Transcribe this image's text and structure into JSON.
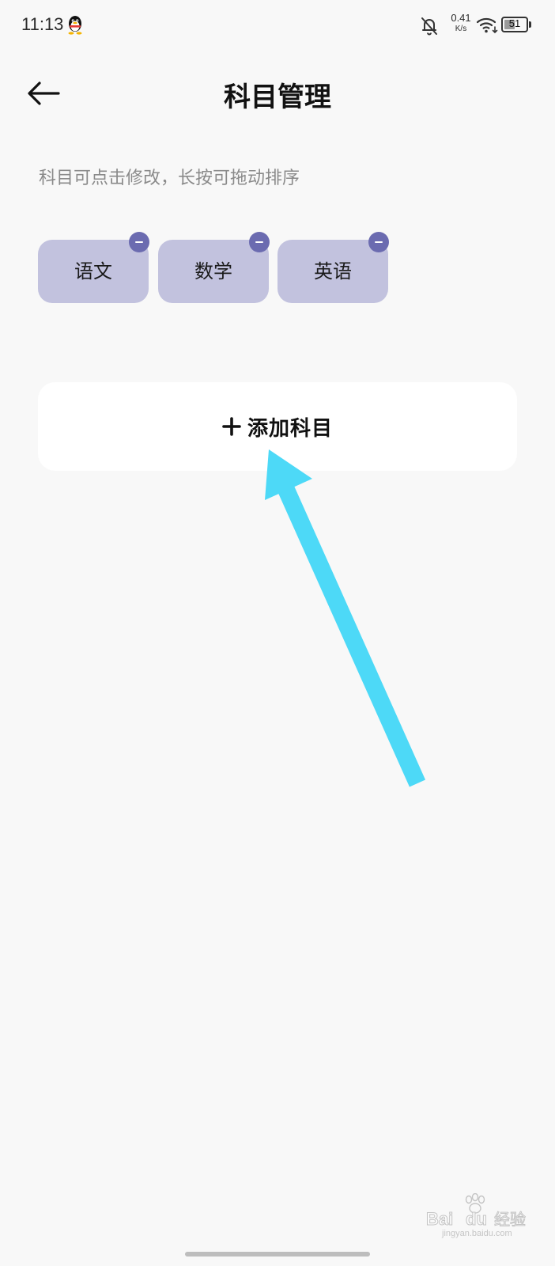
{
  "status_bar": {
    "time": "11:13",
    "net_speed_value": "0.41",
    "net_speed_unit": "K/s",
    "battery_level": "51",
    "battery_fraction": 0.51,
    "icons": [
      "qq-icon",
      "bell-off-icon",
      "wifi-icon",
      "battery-icon"
    ]
  },
  "header": {
    "title": "科目管理",
    "back_icon": "arrow-left-icon"
  },
  "hint": "科目可点击修改，长按可拖动排序",
  "subjects": [
    {
      "label": "语文"
    },
    {
      "label": "数学"
    },
    {
      "label": "英语"
    }
  ],
  "add_button": {
    "icon": "plus-icon",
    "label": "添加科目"
  },
  "annotation": {
    "type": "arrow",
    "color": "#4dd9f7"
  },
  "watermark": {
    "brand": "Bai du 经验",
    "url": "jingyan.baidu.com"
  },
  "colors": {
    "background": "#f8f8f8",
    "chip": "#c2c2de",
    "remove_badge": "#6b6bb0",
    "card": "#ffffff"
  }
}
